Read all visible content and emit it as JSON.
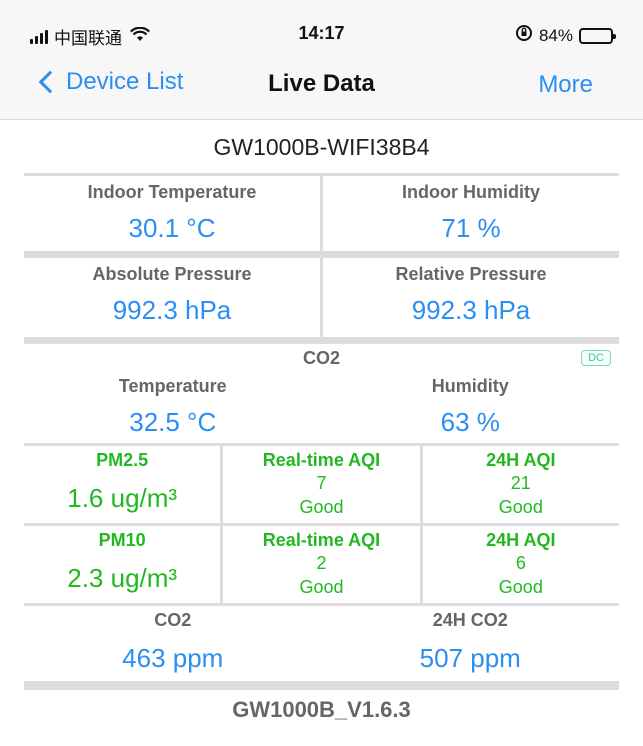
{
  "status_bar": {
    "carrier": "中国联通",
    "time": "14:17",
    "battery_percent": "84%",
    "battery_level": 0.84
  },
  "nav": {
    "back_label": "Device List",
    "title": "Live Data",
    "more_label": "More"
  },
  "device": {
    "name": "GW1000B-WIFI38B4",
    "firmware": "GW1000B_V1.6.3"
  },
  "indoor": {
    "temperature_label": "Indoor Temperature",
    "temperature_value": "30.1 °C",
    "humidity_label": "Indoor Humidity",
    "humidity_value": "71 %"
  },
  "pressure": {
    "absolute_label": "Absolute Pressure",
    "absolute_value": "992.3 hPa",
    "relative_label": "Relative Pressure",
    "relative_value": "992.3 hPa"
  },
  "co2_sensor": {
    "title": "CO2",
    "badge": "DC",
    "temperature_label": "Temperature",
    "temperature_value": "32.5 °C",
    "humidity_label": "Humidity",
    "humidity_value": "63 %"
  },
  "pm25": {
    "label": "PM2.5",
    "value": "1.6 ug/m³",
    "realtime_aqi_label": "Real-time AQI",
    "realtime_aqi_value": "7",
    "realtime_aqi_status": "Good",
    "aqi24_label": "24H AQI",
    "aqi24_value": "21",
    "aqi24_status": "Good"
  },
  "pm10": {
    "label": "PM10",
    "value": "2.3 ug/m³",
    "realtime_aqi_label": "Real-time AQI",
    "realtime_aqi_value": "2",
    "realtime_aqi_status": "Good",
    "aqi24_label": "24H AQI",
    "aqi24_value": "6",
    "aqi24_status": "Good"
  },
  "co2": {
    "label": "CO2",
    "value": "463 ppm",
    "co2_24h_label": "24H CO2",
    "co2_24h_value": "507 ppm"
  },
  "colors": {
    "accent_blue": "#2b8ef2",
    "aqi_green": "#22b822",
    "label_gray": "#666666",
    "divider_gray": "#dcdcdc"
  }
}
